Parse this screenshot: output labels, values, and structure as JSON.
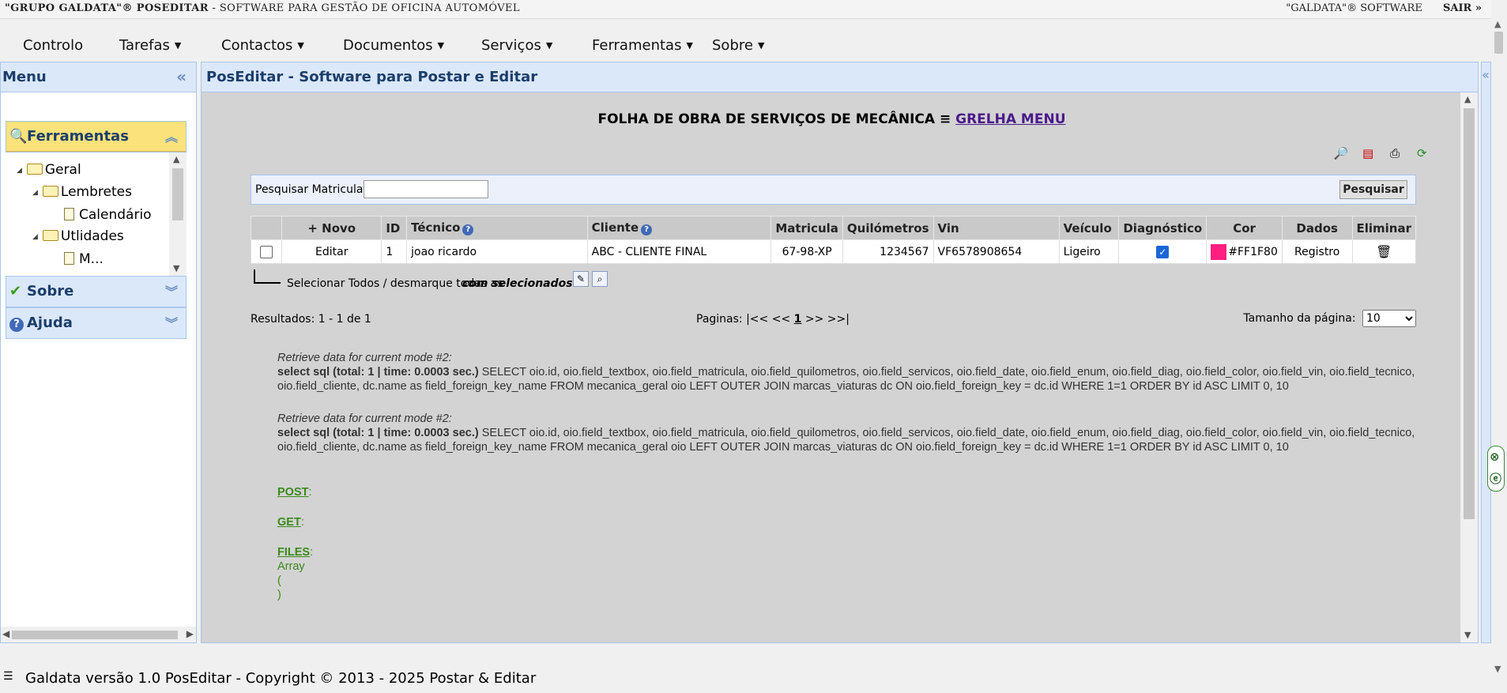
{
  "topbar": {
    "brand": "\"GRUPO GALDATA\"® POSEDITAR",
    "tagline": "- SOFTWARE PARA GESTÃO DE OFICINA AUTOMÓVEL",
    "vendor": "\"GALDATA\"® SOFTWARE",
    "logout": "SAIR »"
  },
  "menu": [
    {
      "label": "Controlo",
      "caret": false
    },
    {
      "label": "Tarefas",
      "caret": true
    },
    {
      "label": "Contactos",
      "caret": true
    },
    {
      "label": "Documentos",
      "caret": true
    },
    {
      "label": "Serviços",
      "caret": true
    },
    {
      "label": "Ferramentas",
      "caret": true
    },
    {
      "label": "Sobre",
      "caret": true
    }
  ],
  "sidebar": {
    "title": "Menu",
    "sections": {
      "ferramentas": "Ferramentas",
      "sobre": "Sobre",
      "ajuda": "Ajuda"
    },
    "tree": {
      "geral": "Geral",
      "lembretes": "Lembretes",
      "calendario": "Calendário",
      "utilidades": "Utlidades",
      "partial": "M..."
    }
  },
  "main": {
    "title": "PosEditar - Software para Postar e Editar",
    "form_title": "FOLHA DE OBRA DE SERVIÇOS DE MECÂNICA ≡",
    "form_link": "GRELHA MENU",
    "search": {
      "label": "Pesquisar Matricula:",
      "value": "",
      "button": "Pesquisar"
    },
    "grid": {
      "headers": {
        "novo": "+ Novo",
        "id": "ID",
        "tecnico": "Técnico",
        "cliente": "Cliente",
        "matricula": "Matricula",
        "quilometros": "Quilómetros",
        "vin": "Vin",
        "veiculo": "Veículo",
        "diagnostico": "Diagnóstico",
        "cor": "Cor",
        "dados": "Dados",
        "eliminar": "Eliminar"
      },
      "row": {
        "editar": "Editar",
        "id": "1",
        "tecnico": "joao ricardo",
        "cliente": "ABC - CLIENTE FINAL",
        "matricula": "67-98-XP",
        "quilometros": "1234567",
        "vin": "VF6578908654",
        "veiculo": "Ligeiro",
        "diagnostico_checked": true,
        "cor": "#FF1F80",
        "dados": "Registro"
      }
    },
    "select_all": "Selecionar Todos / desmarque todas as",
    "with_selected": "com selecionados:",
    "pager": {
      "results": "Resultados: 1 - 1 de 1",
      "pages_label": "Paginas:",
      "pages_nav_left": "|<< <<",
      "current_page": "1",
      "pages_nav_right": ">> >>|",
      "page_size_label": "Tamanho da página:",
      "page_size": "10"
    },
    "debug": [
      {
        "heading": "Retrieve data for current mode #2:",
        "label": "select sql (total: 1 | time: 0.0003 sec.)",
        "sql": "SELECT oio.id, oio.field_textbox, oio.field_matricula, oio.field_quilometros, oio.field_servicos, oio.field_date, oio.field_enum, oio.field_diag, oio.field_color, oio.field_vin, oio.field_tecnico, oio.field_cliente, dc.name as field_foreign_key_name FROM mecanica_geral oio LEFT OUTER JOIN marcas_viaturas dc ON oio.field_foreign_key = dc.id WHERE 1=1 ORDER BY id ASC LIMIT 0, 10"
      },
      {
        "heading": "Retrieve data for current mode #2:",
        "label": "select sql (total: 1 | time: 0.0003 sec.)",
        "sql": "SELECT oio.id, oio.field_textbox, oio.field_matricula, oio.field_quilometros, oio.field_servicos, oio.field_date, oio.field_enum, oio.field_diag, oio.field_color, oio.field_vin, oio.field_tecnico, oio.field_cliente, dc.name as field_foreign_key_name FROM mecanica_geral oio LEFT OUTER JOIN marcas_viaturas dc ON oio.field_foreign_key = dc.id WHERE 1=1 ORDER BY id ASC LIMIT 0, 10"
      }
    ],
    "vars": {
      "post": "POST",
      "get": "GET",
      "files": "FILES",
      "array": "Array",
      "open": "(",
      "close": ")"
    }
  },
  "footer": "Galdata versão 1.0 PosEditar - Copyright © 2013 - 2025 Postar & Editar",
  "colors": {
    "accent": "#1b3e6b",
    "panel_header": "#dbe8f9",
    "active_section": "#fbe27a",
    "link": "#4b1a8a",
    "debug_green": "#3a8a1a"
  }
}
